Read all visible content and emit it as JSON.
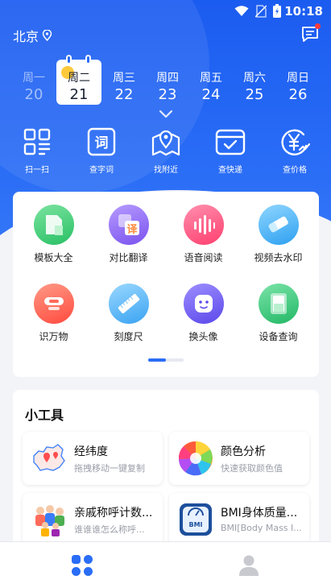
{
  "status": {
    "time": "10:18"
  },
  "location": {
    "city": "北京"
  },
  "week": [
    {
      "weekday": "周一",
      "date": "20",
      "state": "past"
    },
    {
      "weekday": "周二",
      "date": "21",
      "state": "active"
    },
    {
      "weekday": "周三",
      "date": "22",
      "state": "future"
    },
    {
      "weekday": "周四",
      "date": "23",
      "state": "future"
    },
    {
      "weekday": "周五",
      "date": "24",
      "state": "future"
    },
    {
      "weekday": "周六",
      "date": "25",
      "state": "future"
    },
    {
      "weekday": "周日",
      "date": "26",
      "state": "future"
    }
  ],
  "quick_actions": [
    {
      "label": "扫一扫",
      "icon": "scan-icon"
    },
    {
      "label": "查字词",
      "icon": "dictionary-icon"
    },
    {
      "label": "找附近",
      "icon": "map-pin-icon"
    },
    {
      "label": "查快递",
      "icon": "package-icon"
    },
    {
      "label": "查价格",
      "icon": "price-icon"
    }
  ],
  "feature_grid": [
    {
      "label": "模板大全",
      "icon": "template-icon",
      "color": "#3ecf7a"
    },
    {
      "label": "对比翻译",
      "icon": "translate-icon",
      "color": "#8a63f2"
    },
    {
      "label": "语音阅读",
      "icon": "voice-icon",
      "color": "#ff4f7e"
    },
    {
      "label": "视频去水印",
      "icon": "eraser-icon",
      "color": "#3fb3f5"
    },
    {
      "label": "识万物",
      "icon": "recognize-icon",
      "color": "#ff5a4e"
    },
    {
      "label": "刻度尺",
      "icon": "ruler-icon",
      "color": "#40a9f5"
    },
    {
      "label": "换头像",
      "icon": "avatar-face-icon",
      "color": "#6a5cf0"
    },
    {
      "label": "设备查询",
      "icon": "device-icon",
      "color": "#2fc77a"
    }
  ],
  "tools": {
    "title": "小工具",
    "items": [
      {
        "name": "经纬度",
        "subtitle": "拖拽移动一键复制",
        "icon": "china-map-icon"
      },
      {
        "name": "颜色分析",
        "subtitle": "快速获取颜色值",
        "icon": "color-wheel-icon"
      },
      {
        "name": "亲戚称呼计数...",
        "subtitle": "谁谁谁怎么称呼...",
        "icon": "family-icon"
      },
      {
        "name": "BMI身体质量...",
        "subtitle": "BMI[Body Mass I...",
        "icon": "bmi-scale-icon"
      }
    ]
  },
  "bmi_badge": "BMI",
  "colors": {
    "primary": "#2a6df6",
    "accent": "#ffc93c"
  }
}
